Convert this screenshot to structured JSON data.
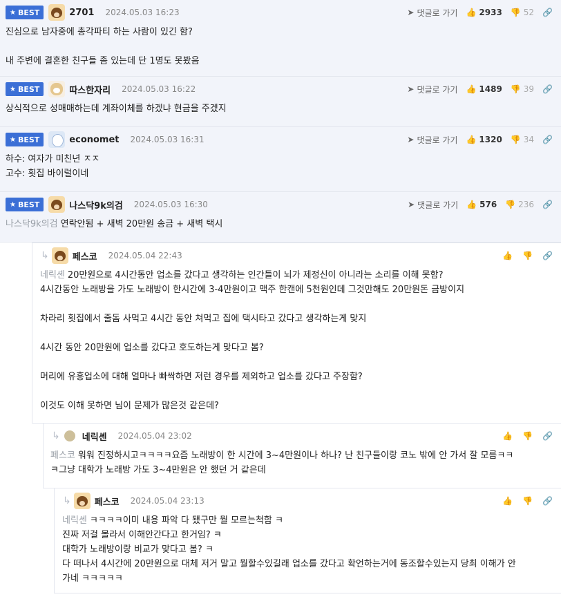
{
  "comments": [
    {
      "badge": "BEST",
      "nick": "2701",
      "date": "2024.05.03 16:23",
      "reply": "댓글로 가기",
      "up": "2933",
      "down": "52",
      "lines": [
        "진심으로 남자중에 총각파티 하는 사람이 있긴 함?",
        "",
        "내 주변에 결혼한 친구들 좀 있는데 단 1명도 못봤음"
      ]
    },
    {
      "badge": "BEST",
      "nick": "따스한자리",
      "date": "2024.05.03 16:22",
      "reply": "댓글로 가기",
      "up": "1489",
      "down": "39",
      "lines": [
        "상식적으로 성매매하는데 계좌이체를 하겠냐 현금을 주겠지"
      ]
    },
    {
      "badge": "BEST",
      "nick": "economet",
      "date": "2024.05.03 16:31",
      "reply": "댓글로 가기",
      "up": "1320",
      "down": "34",
      "lines": [
        "하수: 여자가 미친년 ㅈㅈ",
        "고수: 횟집 바이럴이네"
      ]
    },
    {
      "badge": "BEST",
      "nick": "나스닥9k의검",
      "date": "2024.05.03 16:30",
      "reply": "댓글로 가기",
      "up": "576",
      "down": "236",
      "mention": "나스닥9k의검",
      "text": "연락안됨 + 새벽 20만원 송금 + 새벽 택시"
    }
  ],
  "replies": [
    {
      "nick": "페스코",
      "date": "2024.05.04 22:43",
      "mention": "네릭셴",
      "first": "20만원으로 4시간동안 업소를 갔다고 생각하는 인간들이 뇌가 제정신이 아니라는 소리를 이해 못함?",
      "lines": [
        "4시간동안 노래방을 가도 노래방이 한시간에 3-4만원이고 맥주 한캔에 5천원인데 그것만해도 20만원돈 금방이지",
        "",
        "차라리 횟집에서 줄돔 사먹고 4시간 동안 쳐먹고 집에 택시타고 갔다고 생각하는게 맞지",
        "",
        "4시간 동안 20만원에 업소를 갔다고 호도하는게 맞다고 봄?",
        "",
        "머리에 유흥업소에 대해 얼마나 빠싹하면 저런 경우를 제외하고 업소를 갔다고 주장함?",
        "",
        "이것도 이해 못하면 님이 문제가 많은것 같은데?"
      ]
    },
    {
      "nick": "네릭셴",
      "date": "2024.05.04 23:02",
      "mention": "페스코",
      "first": "워워 진정하시고ㅋㅋㅋㅋ요즘 노래방이 한 시간에 3~4만원이나 하나? 난 친구들이랑 코노 밖에 안 가서 잘 모름ㅋㅋ",
      "lines": [
        "ㅋ그냥 대학가 노래방 가도 3~4만원은 안 했던 거 같은데"
      ]
    },
    {
      "nick": "페스코",
      "date": "2024.05.04 23:13",
      "mention": "네릭셴",
      "first": "ㅋㅋㅋㅋ이미 내용 파악 다 됐구만 뭘 모르는척함 ㅋ",
      "lines": [
        "진짜 저걸 몰라서 이해안간다고 한거임? ㅋ",
        "대학가 노래방이랑 비교가 맞다고 봄? ㅋ",
        "다 떠나서 4시간에 20만원으로 대체 저거 말고 뭘할수있길래 업소를 갔다고 확언하는거에 동조할수있는지 당최 이해가 안",
        "가네 ㅋㅋㅋㅋㅋ"
      ]
    }
  ]
}
